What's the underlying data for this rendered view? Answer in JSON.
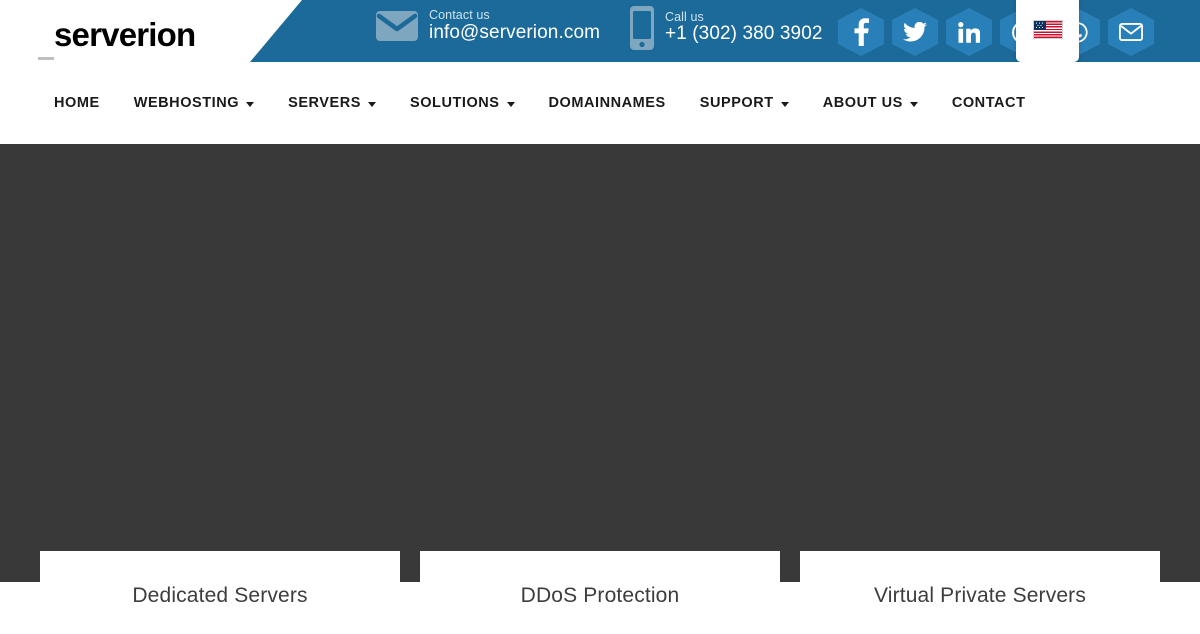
{
  "brand": {
    "logo_text": "serverion",
    "accent_blue": "#1b6a99",
    "social_blue": "#2980b9",
    "hero_dark": "#393939"
  },
  "topbar": {
    "contact": {
      "label": "Contact us",
      "value": "info@serverion.com",
      "icon": "mail-icon"
    },
    "call": {
      "label": "Call us",
      "value": "+1 (302) 380 3902",
      "icon": "phone-icon"
    },
    "social": [
      {
        "name": "facebook-icon",
        "glyph": "f"
      },
      {
        "name": "twitter-icon",
        "glyph": ""
      },
      {
        "name": "linkedin-icon",
        "glyph": "in"
      },
      {
        "name": "skype-icon",
        "glyph": ""
      },
      {
        "name": "whatsapp-icon",
        "glyph": ""
      },
      {
        "name": "email-icon",
        "glyph": ""
      }
    ],
    "language": {
      "selected": "en_US",
      "flag": "us-flag-icon"
    }
  },
  "nav": {
    "items": [
      {
        "label": "HOME",
        "has_dropdown": false
      },
      {
        "label": "WEBHOSTING",
        "has_dropdown": true
      },
      {
        "label": "SERVERS",
        "has_dropdown": true
      },
      {
        "label": "SOLUTIONS",
        "has_dropdown": true
      },
      {
        "label": "DOMAINNAMES",
        "has_dropdown": false
      },
      {
        "label": "SUPPORT",
        "has_dropdown": true
      },
      {
        "label": "ABOUT US",
        "has_dropdown": true
      },
      {
        "label": "CONTACT",
        "has_dropdown": false
      }
    ]
  },
  "hero": {
    "background": "#393939"
  },
  "cards": [
    {
      "title": "Dedicated Servers"
    },
    {
      "title": "DDoS Protection"
    },
    {
      "title": "Virtual Private Servers"
    }
  ]
}
